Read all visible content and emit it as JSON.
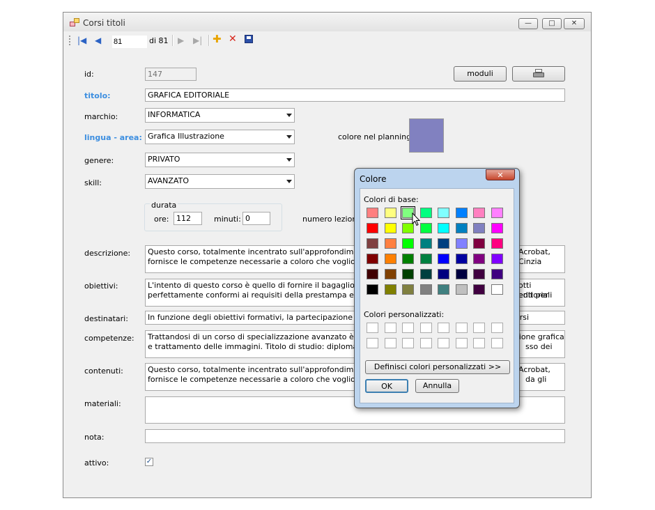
{
  "window": {
    "title": "Corsi titoli",
    "minimize": "—",
    "maximize": "□",
    "close": "✕"
  },
  "toolbar": {
    "position": "81",
    "of_label": "di 81"
  },
  "form": {
    "id_label": "id:",
    "id_value": "147",
    "moduli_button": "moduli",
    "titolo_label": "titolo:",
    "titolo_value": "GRAFICA EDITORIALE",
    "marchio_label": "marchio:",
    "marchio_value": "INFORMATICA",
    "lingua_label": "lingua - area:",
    "lingua_value": "Grafica Illustrazione",
    "colore_label": "colore nel planning:",
    "colore_hex": "#8181c0",
    "genere_label": "genere:",
    "genere_value": "PRIVATO",
    "skill_label": "skill:",
    "skill_value": "AVANZATO",
    "durata_label": "durata",
    "ore_label": "ore:",
    "ore_value": "112",
    "minuti_label": "minuti:",
    "minuti_value": "0",
    "lezioni_label": "numero lezioni:",
    "descrizione_label": "descrizione:",
    "descrizione_l1": "Questo corso, totalmente incentrato sull'approfondimento degli a",
    "descrizione_l1b": "Acrobat,",
    "descrizione_l2": "fornisce le competenze necessarie a coloro che vogliono opera",
    "descrizione_l2b": "Cinzia",
    "obiettivi_label": "obiettivi:",
    "obiettivi_l1": "L'intento di questo corso è quello di fornire il bagaglio di conosc",
    "obiettivi_l1b": "otti editoriali",
    "obiettivi_l2": "perfettamente conformi ai requisiti della prestampa e della stamp",
    "obiettivi_l2b": "enti per",
    "destinatari_label": "destinatari:",
    "destinatari_l1": "In funzione degli obiettivi formativi, la partecipazione ai corsi spe",
    "destinatari_l1b": "orsi coordinat",
    "competenze_label": "competenze:",
    "competenze_l1": "Trattandosi di un corso di specializzazione avanzato è richiesta",
    "competenze_l1b": "zione grafica",
    "competenze_l2": "e trattamento delle immagini. Titolo di studio: diploma superiore.",
    "competenze_l2b": "sso dei",
    "contenuti_label": "contenuti:",
    "contenuti_l1": "Questo corso, totalmente incentrato sull'approfondimento degli a",
    "contenuti_l1b": "Acrobat,",
    "contenuti_l2": "fornisce le competenze necessarie a coloro che vogliono opera",
    "contenuti_l2b": "da gli",
    "materiali_label": "materiali:",
    "nota_label": "nota:",
    "attivo_label": "attivo:",
    "attivo_check": "✓"
  },
  "dialog": {
    "title": "Colore",
    "close": "✕",
    "base_label": "Colori di base:",
    "custom_label": "Colori personalizzati:",
    "define_button": "Definisci colori personalizzati >>",
    "ok_button": "OK",
    "cancel_button": "Annulla",
    "base_colors": [
      [
        "#ff8080",
        "#ffff80",
        "#80ff80",
        "#00ff80",
        "#80ffff",
        "#0080ff",
        "#ff80c0",
        "#ff80ff"
      ],
      [
        "#ff0000",
        "#ffff00",
        "#80ff00",
        "#00ff40",
        "#00ffff",
        "#0080c0",
        "#8080c0",
        "#ff00ff"
      ],
      [
        "#804040",
        "#ff8040",
        "#00ff00",
        "#008080",
        "#004080",
        "#8080ff",
        "#800040",
        "#ff0080"
      ],
      [
        "#800000",
        "#ff8000",
        "#008000",
        "#008040",
        "#0000ff",
        "#0000a0",
        "#800080",
        "#8000ff"
      ],
      [
        "#400000",
        "#804000",
        "#004000",
        "#004040",
        "#000080",
        "#000040",
        "#400040",
        "#400080"
      ],
      [
        "#000000",
        "#808000",
        "#808040",
        "#808080",
        "#408080",
        "#c0c0c0",
        "#400040",
        "#ffffff"
      ]
    ]
  }
}
